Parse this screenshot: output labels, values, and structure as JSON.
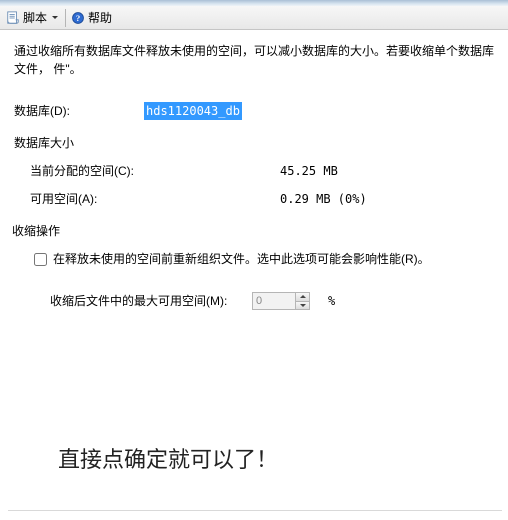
{
  "toolbar": {
    "script_label": "脚本",
    "help_label": "帮助"
  },
  "description": "通过收缩所有数据库文件释放未使用的空间，可以减小数据库的大小。若要收缩单个数据库文件，\n件\"。",
  "fields": {
    "database_label": "数据库(D):",
    "database_value": "hds1120043_db",
    "size_section_label": "数据库大小",
    "allocated_label": "当前分配的空间(C):",
    "allocated_value": "45.25 MB",
    "free_label": "可用空间(A):",
    "free_value": "0.29 MB (0%)"
  },
  "shrink": {
    "section_label": "收缩操作",
    "checkbox_label": "在释放未使用的空间前重新组织文件。选中此选项可能会影响性能(R)。",
    "max_free_label": "收缩后文件中的最大可用空间(M):",
    "max_free_value": "0",
    "percent_symbol": "%"
  },
  "annotation": "直接点确定就可以了！"
}
